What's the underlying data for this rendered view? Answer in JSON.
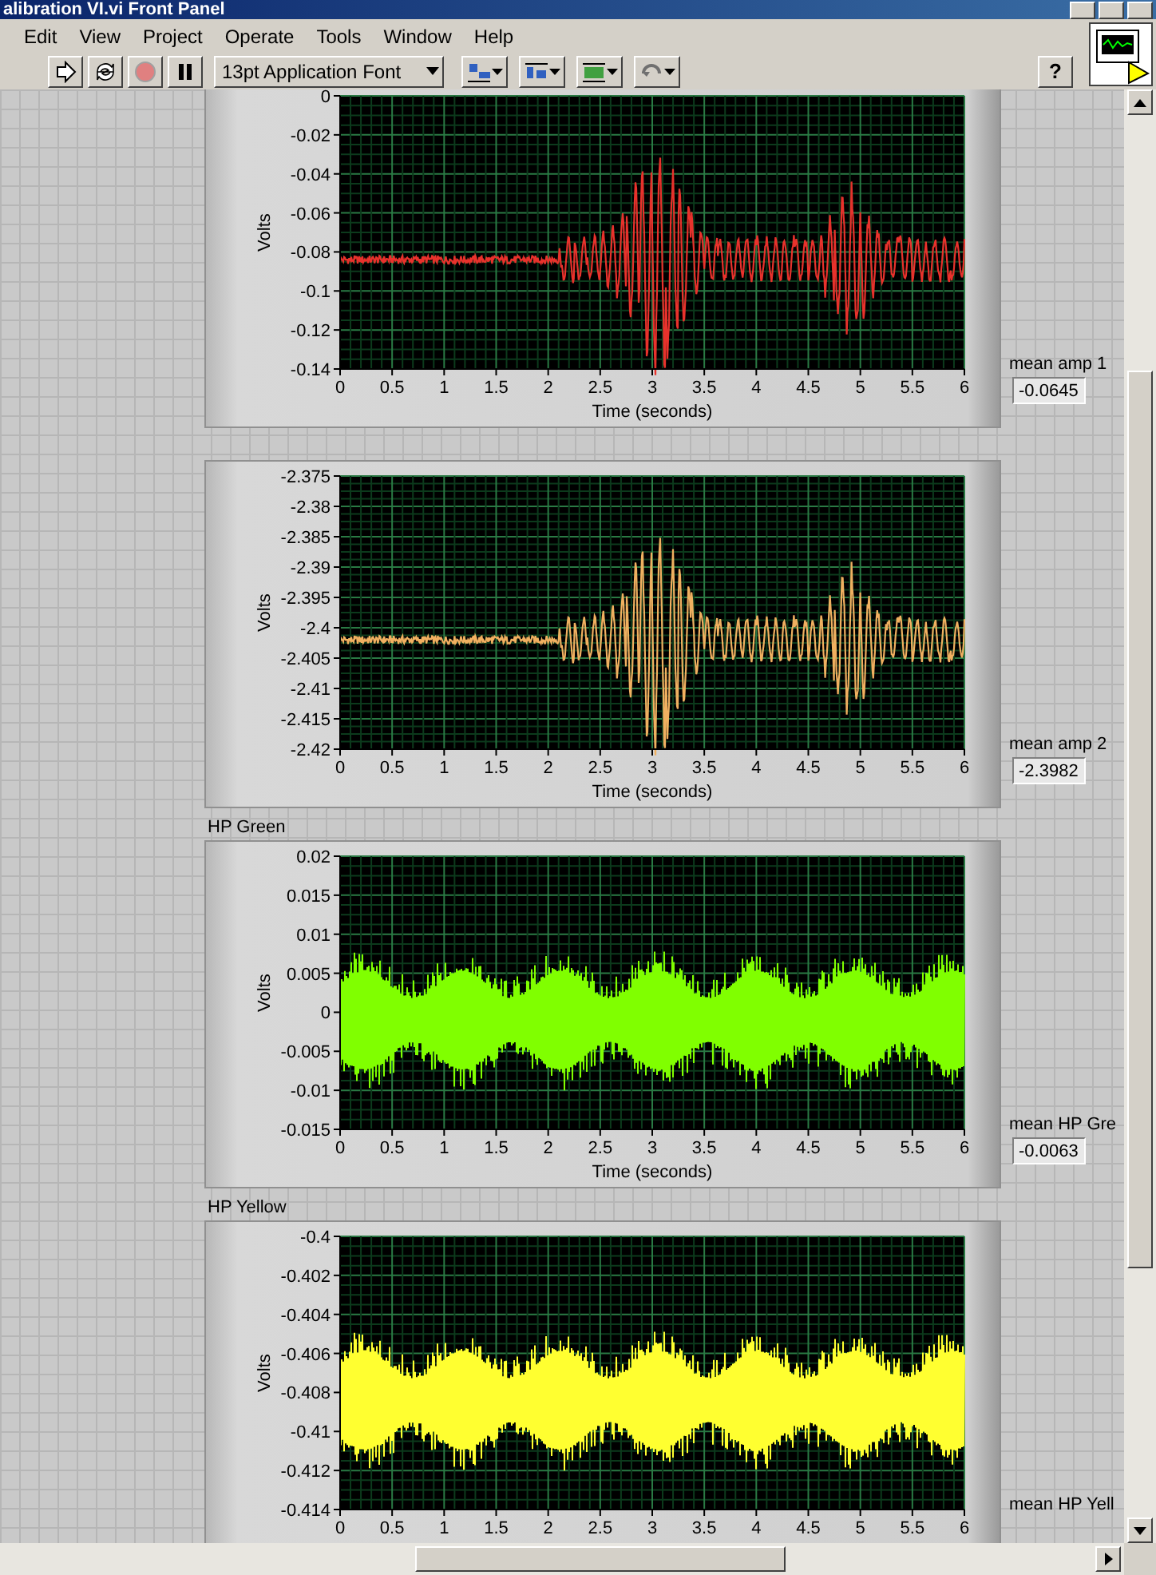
{
  "window": {
    "title": "alibration VI.vi Front Panel"
  },
  "menu": [
    "Edit",
    "View",
    "Project",
    "Operate",
    "Tools",
    "Window",
    "Help"
  ],
  "toolbar": {
    "font": "13pt Application Font",
    "help": "?"
  },
  "graphs": [
    {
      "kind": "burst",
      "color": "#e8322c",
      "ylabel": "Volts",
      "xlabel": "Time (seconds)",
      "yticks": [
        "0",
        "-0.02",
        "-0.04",
        "-0.06",
        "-0.08",
        "-0.1",
        "-0.12",
        "-0.14"
      ],
      "xticks": [
        "0",
        "0.5",
        "1",
        "1.5",
        "2",
        "2.5",
        "3",
        "3.5",
        "4",
        "4.5",
        "5",
        "5.5",
        "6"
      ],
      "indicator": {
        "label": "mean amp 1",
        "value": "-0.0645"
      }
    },
    {
      "kind": "burst",
      "color": "#f0b060",
      "ylabel": "Volts",
      "xlabel": "Time (seconds)",
      "yticks": [
        "-2.375",
        "-2.38",
        "-2.385",
        "-2.39",
        "-2.395",
        "-2.4",
        "-2.405",
        "-2.41",
        "-2.415",
        "-2.42"
      ],
      "xticks": [
        "0",
        "0.5",
        "1",
        "1.5",
        "2",
        "2.5",
        "3",
        "3.5",
        "4",
        "4.5",
        "5",
        "5.5",
        "6"
      ],
      "indicator": {
        "label": "mean amp 2",
        "value": "-2.3982"
      }
    },
    {
      "kind": "band",
      "label": "HP Green",
      "color": "#80ff00",
      "ylabel": "Volts",
      "xlabel": "Time (seconds)",
      "yticks": [
        "0.02",
        "0.015",
        "0.01",
        "0.005",
        "0",
        "-0.005",
        "-0.01",
        "-0.015"
      ],
      "xticks": [
        "0",
        "0.5",
        "1",
        "1.5",
        "2",
        "2.5",
        "3",
        "3.5",
        "4",
        "4.5",
        "5",
        "5.5",
        "6"
      ],
      "indicator": {
        "label": "mean HP Gre",
        "value": "-0.0063"
      }
    },
    {
      "kind": "band",
      "label": "HP Yellow",
      "color": "#ffff30",
      "ylabel": "Volts",
      "yticks": [
        "-0.4",
        "-0.402",
        "-0.404",
        "-0.406",
        "-0.408",
        "-0.41",
        "-0.412",
        "-0.414"
      ],
      "xticks": [
        "0",
        "0.5",
        "1",
        "1.5",
        "2",
        "2.5",
        "3",
        "3.5",
        "4",
        "4.5",
        "5",
        "5.5",
        "6"
      ],
      "indicator": {
        "label": "mean HP Yell"
      }
    }
  ]
}
